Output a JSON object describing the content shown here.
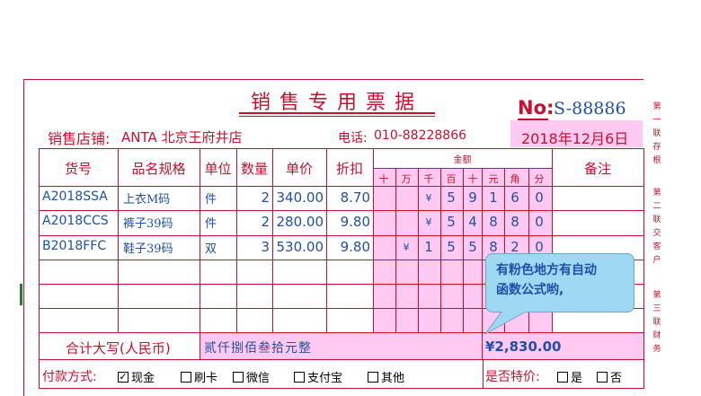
{
  "receipt": {
    "title": "销售专用票据",
    "no_label": "No:",
    "no_value": "S-88886",
    "side_notes": [
      "第一联存根",
      "第二联交客户",
      "第三联财务"
    ],
    "store_label": "销售店铺:",
    "store_value": "ANTA 北京王府井店",
    "phone_label": "电话:",
    "phone_value": "010-88228866",
    "date": "2018年12月6日"
  },
  "table": {
    "headers": {
      "code": "货号",
      "name": "品名规格",
      "unit": "单位",
      "qty": "数量",
      "price": "单价",
      "discount": "折扣",
      "amount": "金额",
      "remark": "备注"
    },
    "amount_digits": [
      "十",
      "万",
      "千",
      "百",
      "十",
      "元",
      "角",
      "分"
    ],
    "rows": [
      {
        "code": "A2018SSA",
        "name": "上衣M码",
        "unit": "件",
        "qty": "2",
        "price": "340.00",
        "discount": "8.70",
        "digits": [
          "",
          "",
          "¥",
          "5",
          "9",
          "1",
          "6",
          "0"
        ]
      },
      {
        "code": "A2018CCS",
        "name": "裤子39码",
        "unit": "件",
        "qty": "2",
        "price": "280.00",
        "discount": "9.80",
        "digits": [
          "",
          "",
          "¥",
          "5",
          "4",
          "8",
          "8",
          "0"
        ]
      },
      {
        "code": "B2018FFC",
        "name": "鞋子39码",
        "unit": "双",
        "qty": "3",
        "price": "530.00",
        "discount": "9.80",
        "digits": [
          "",
          "¥",
          "1",
          "5",
          "5",
          "8",
          "2",
          "0"
        ]
      }
    ],
    "total_label": "合计大写(人民币)",
    "total_words": "贰仟捌佰叁拾元整",
    "total_value": "¥2,830.00"
  },
  "payment": {
    "label": "付款方式:",
    "options": [
      {
        "label": "现金",
        "checked": true
      },
      {
        "label": "刷卡",
        "checked": false
      },
      {
        "label": "微信",
        "checked": false
      },
      {
        "label": "支付宝",
        "checked": false
      },
      {
        "label": "其他",
        "checked": false
      }
    ],
    "special_label": "是否特价:",
    "special_options": [
      {
        "label": "是",
        "checked": false
      },
      {
        "label": "否",
        "checked": false
      }
    ]
  },
  "callout": {
    "line1": "有粉色地方有自动",
    "line2": "函数公式哟,"
  }
}
